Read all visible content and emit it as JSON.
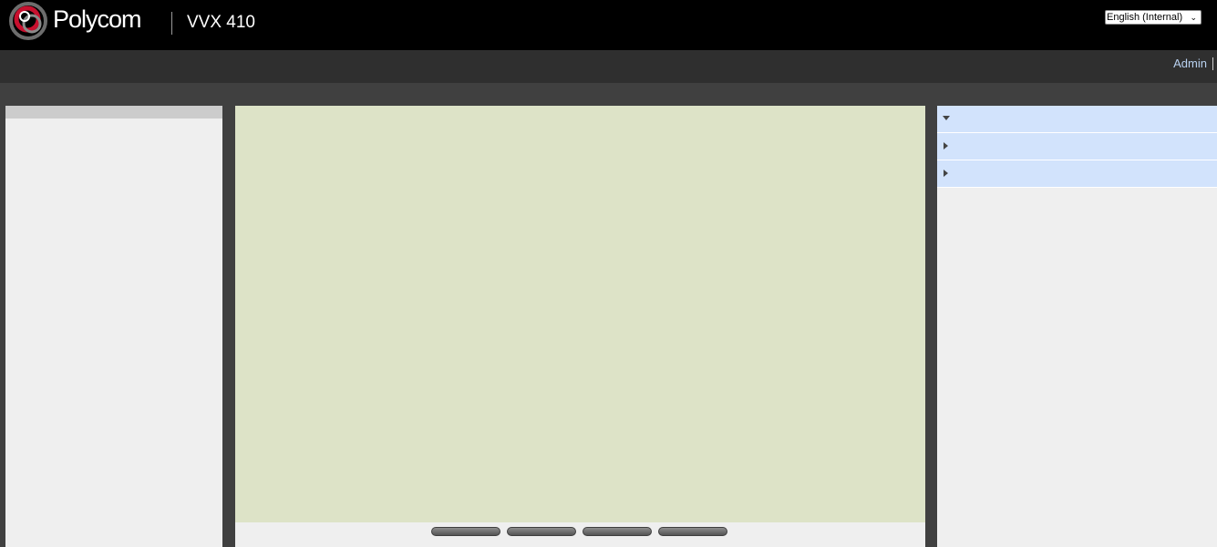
{
  "header": {
    "brand": "Polycom",
    "model": "VVX 410",
    "language": "English (Internal)"
  },
  "admin_bar": {
    "user_link": "Admin"
  },
  "colors": {
    "header_bg": "#000000",
    "admin_bar_bg": "#2f2f2f",
    "page_bg": "#404040",
    "phone_screen": "#dde3c7",
    "accordion_bg": "#d2e3fc",
    "link": "#b9d2f1",
    "logo_red": "#c8102e"
  },
  "icons": {
    "logo": "polycom-logo-icon",
    "language_dropdown": "chevron-down-icon",
    "accordion_expanded": "triangle-down-icon",
    "accordion_collapsed": "triangle-right-icon"
  },
  "right_panel": {
    "sections": [
      {
        "state": "expanded"
      },
      {
        "state": "collapsed"
      },
      {
        "state": "collapsed"
      }
    ]
  },
  "softkeys_count": 4
}
